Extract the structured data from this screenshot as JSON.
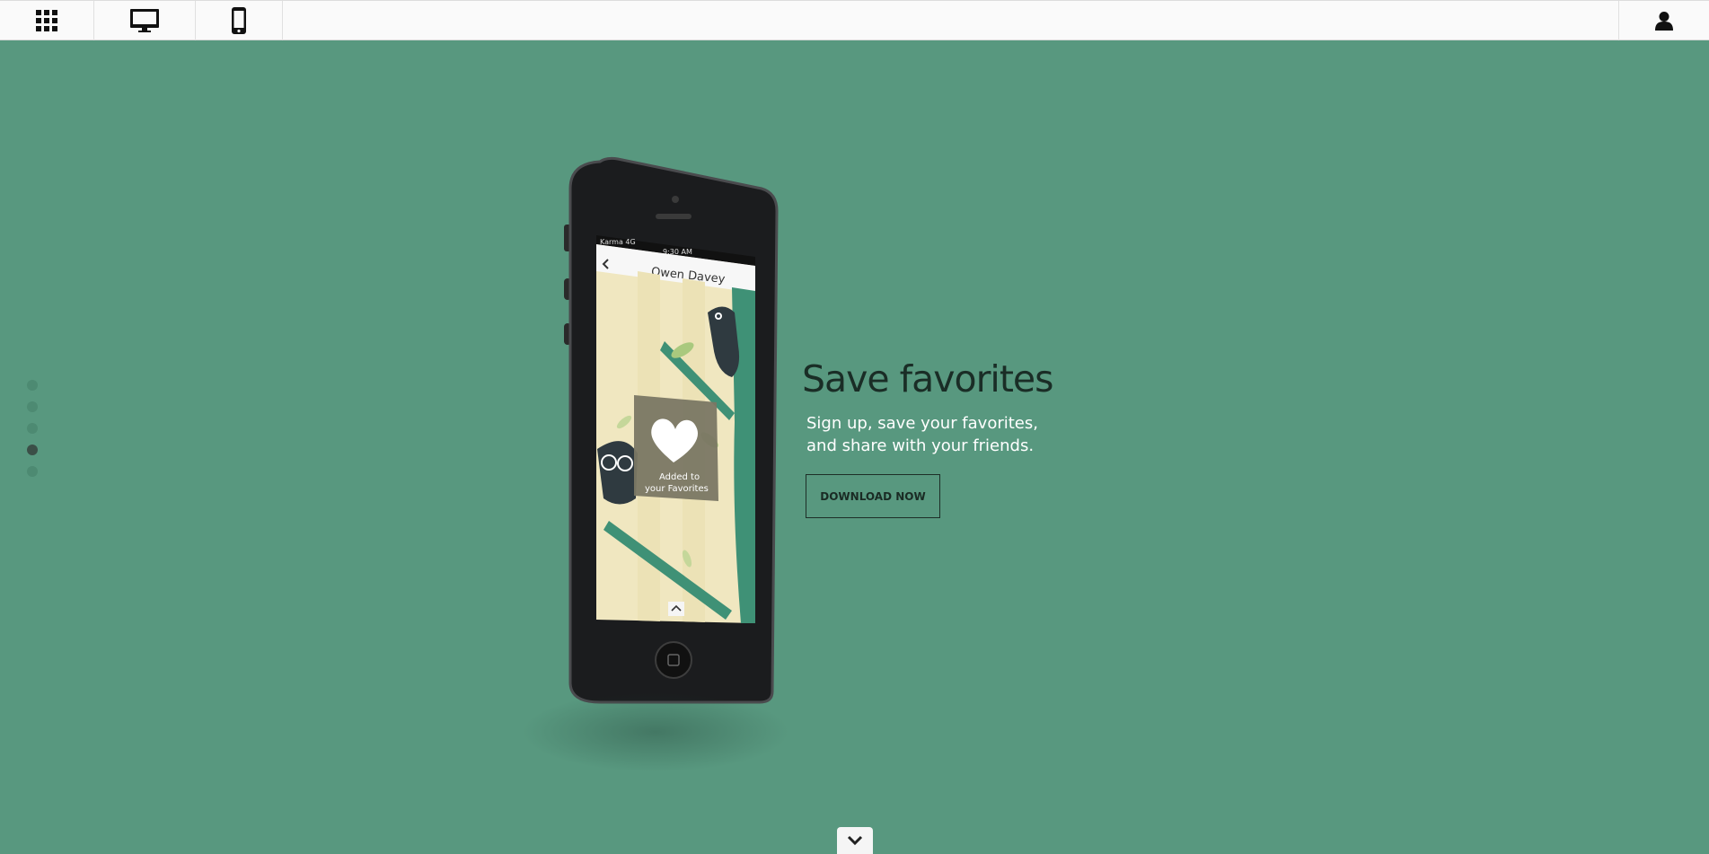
{
  "topbar": {
    "apps_icon": "grid-icon",
    "desktop_icon": "desktop-icon",
    "mobile_icon": "mobile-phone-icon",
    "user_icon": "user-icon"
  },
  "pagination": {
    "count": 5,
    "active_index": 3
  },
  "phone": {
    "carrier": "Karma 4G",
    "time": "9:30 AM",
    "screen_title": "Owen Davey",
    "toast": {
      "line1": "Added to",
      "line2": "your Favorites"
    }
  },
  "hero": {
    "title": "Save favorites",
    "subtitle_line1": "Sign up, save your favorites,",
    "subtitle_line2": "and share with your friends.",
    "button_label": "DOWNLOAD NOW"
  },
  "colors": {
    "background": "#58987f",
    "topbar": "#fafafa",
    "title": "#1a2d26",
    "subtitle": "#ffffff"
  }
}
